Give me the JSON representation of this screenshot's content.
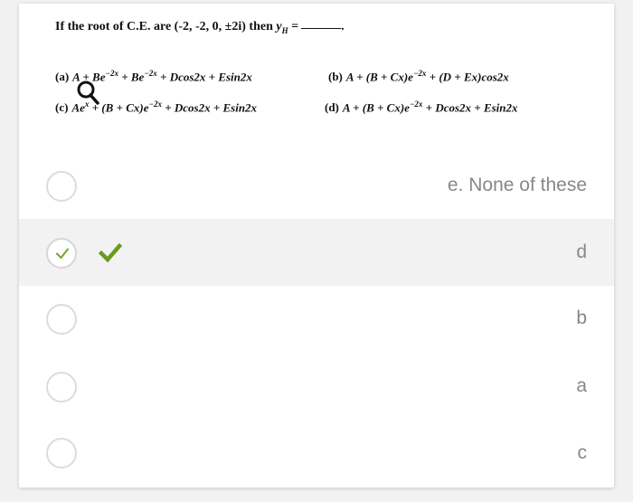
{
  "question": {
    "stem_prefix": "If the root of C.E. are (-2, -2, 0, ±2i) then",
    "stem_symbol": "y",
    "stem_subscript": "H",
    "stem_equals": "=",
    "options": {
      "a": {
        "tag": "(a)",
        "before_exp": "A + Be",
        "exp1": "−2x",
        "mid": " + Be",
        "exp2": "−2x",
        "after": " + Dcos2x + Esin2x"
      },
      "b": {
        "tag": "(b)",
        "before_exp": "A + (B + Cx)e",
        "exp1": "−2x",
        "after": " + (D + Ex)cos2x"
      },
      "c": {
        "tag": "(c)",
        "before_exp": "Ae",
        "exp1": "x",
        "after": " + (B + Cx)e",
        "exp2": "−2x",
        "tail": " + Dcos2x + Esin2x"
      },
      "d": {
        "tag": "(d)",
        "before_exp": "A + (B + Cx)e",
        "exp1": "−2x",
        "after": " + Dcos2x + Esin2x"
      }
    }
  },
  "choices": [
    {
      "label": "e. None of these",
      "selected": false,
      "correct": false
    },
    {
      "label": "d",
      "selected": true,
      "correct": true
    },
    {
      "label": "b",
      "selected": false,
      "correct": false
    },
    {
      "label": "a",
      "selected": false,
      "correct": false
    },
    {
      "label": "c",
      "selected": false,
      "correct": false
    }
  ],
  "icons": {
    "magnifier": "magnifier-icon",
    "check": "check-icon",
    "correct_mark": "green-checkmark-icon"
  },
  "colors": {
    "correct_green": "#6a9a1f",
    "radio_check_green": "#7aa83a",
    "label_gray": "#888888",
    "selected_row_bg": "#f2f2f2"
  }
}
